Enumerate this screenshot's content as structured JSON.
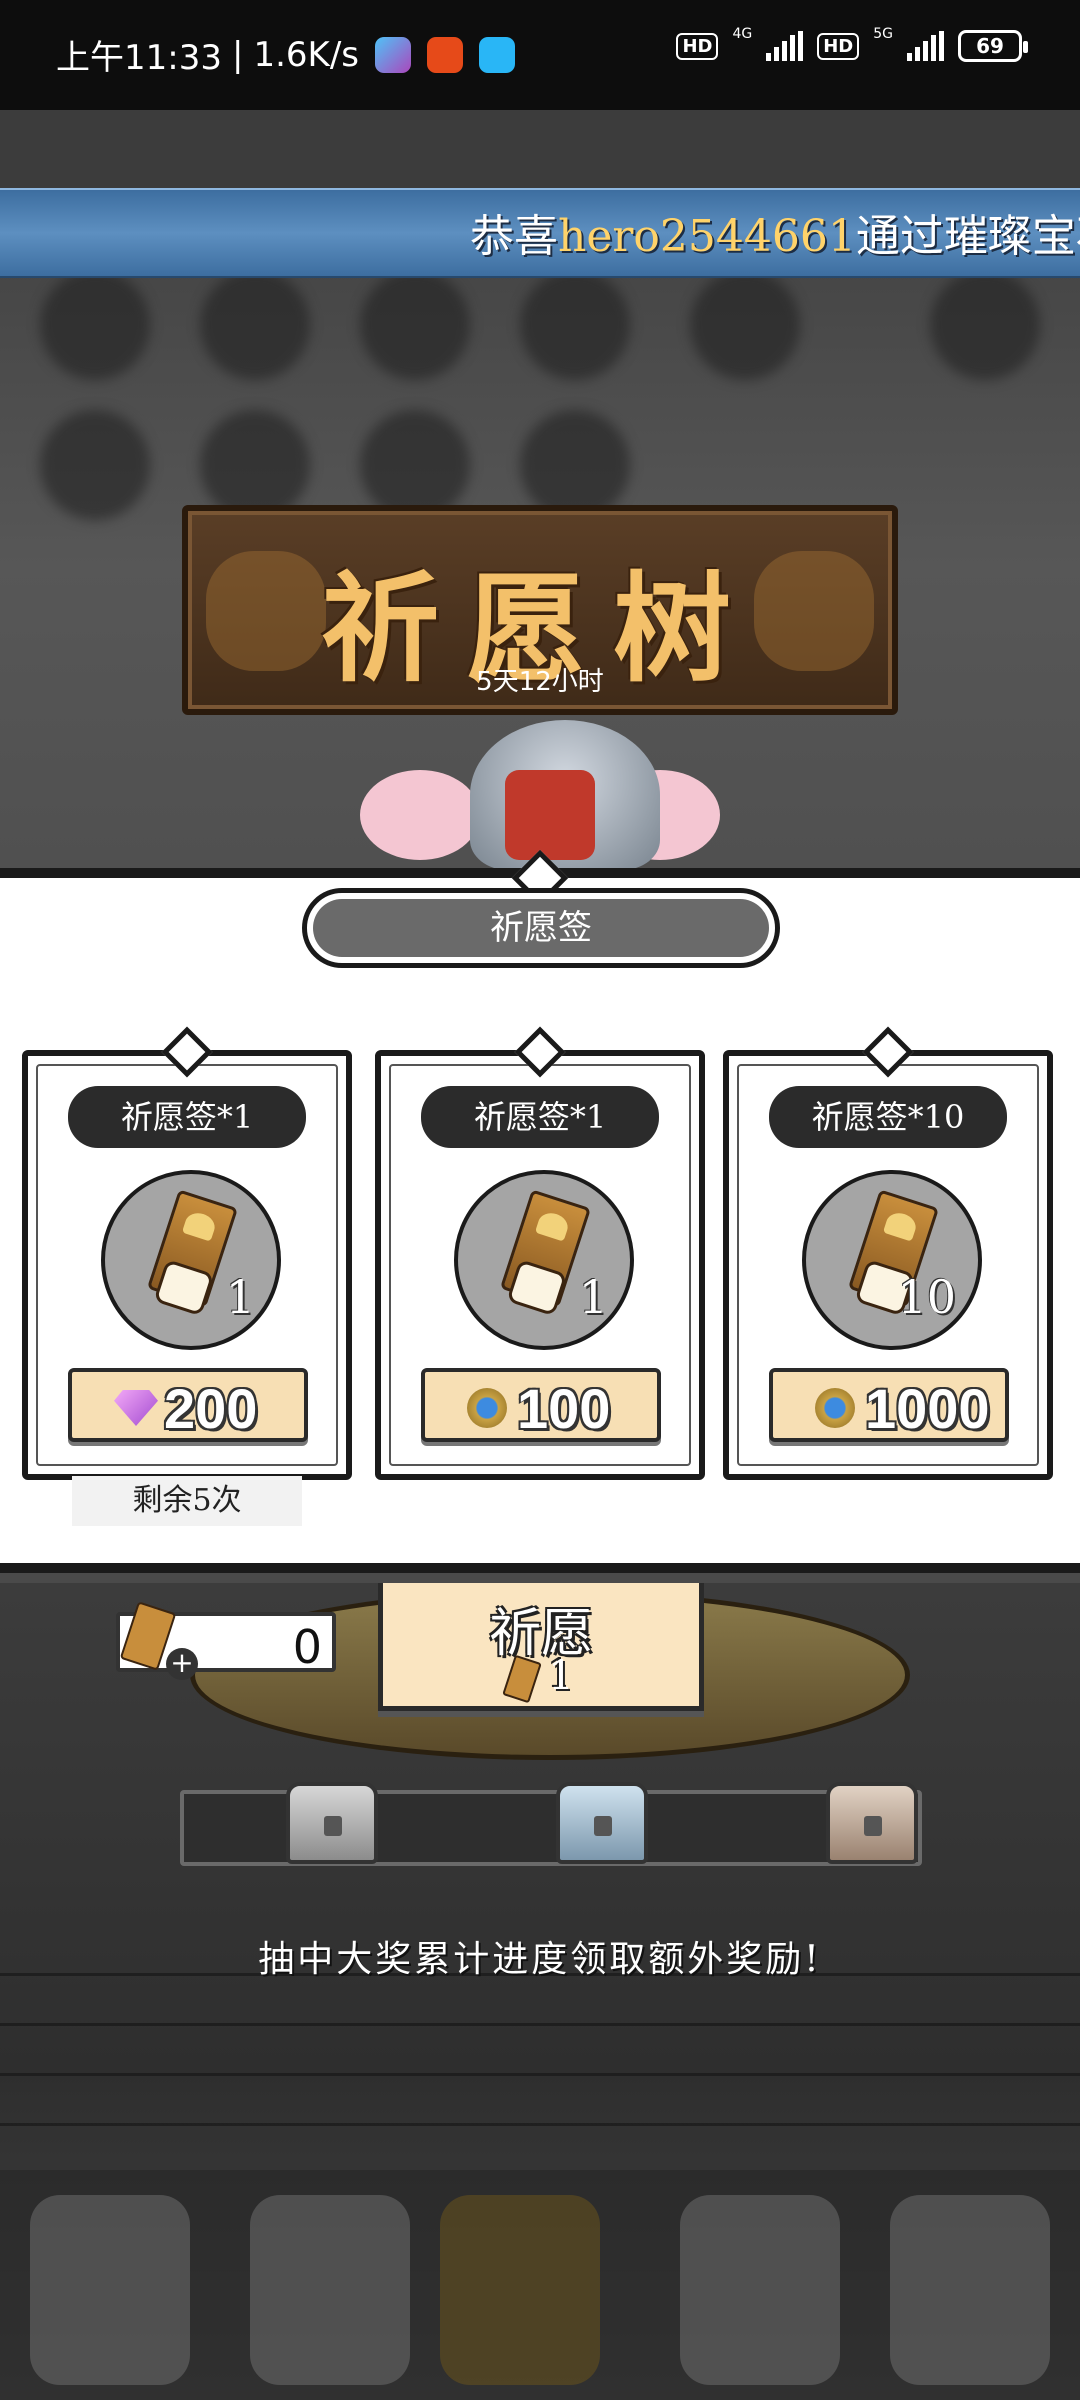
{
  "status_bar": {
    "time": "上午11:33",
    "speed": "1.6K/s",
    "separator": "|",
    "net1": "4G",
    "net2": "5G",
    "hd": "HD",
    "battery": "69"
  },
  "banner": {
    "prefix": "恭喜",
    "player": "hero2544661",
    "suffix": "通过璀璨宝石"
  },
  "event": {
    "title": "祈愿树",
    "countdown": "5天12小时"
  },
  "panel": {
    "tab_label": "祈愿签",
    "cards": [
      {
        "label": "祈愿签*1",
        "qty": "1",
        "currency": "gem",
        "price": "200"
      },
      {
        "label": "祈愿签*1",
        "qty": "1",
        "currency": "coin",
        "price": "100"
      },
      {
        "label": "祈愿签*10",
        "qty": "10",
        "currency": "coin",
        "price": "1000"
      }
    ],
    "remaining": "剩余5次"
  },
  "wish": {
    "ticket_count": "0",
    "plus": "+",
    "button_label": "祈愿",
    "button_cost": "1"
  },
  "progress_hint": "抽中大奖累计进度领取额外奖励!",
  "colors": {
    "banner_highlight": "#ffd36a",
    "title_gold": "#f3c06a",
    "price_bg": "#f7dfb4"
  }
}
